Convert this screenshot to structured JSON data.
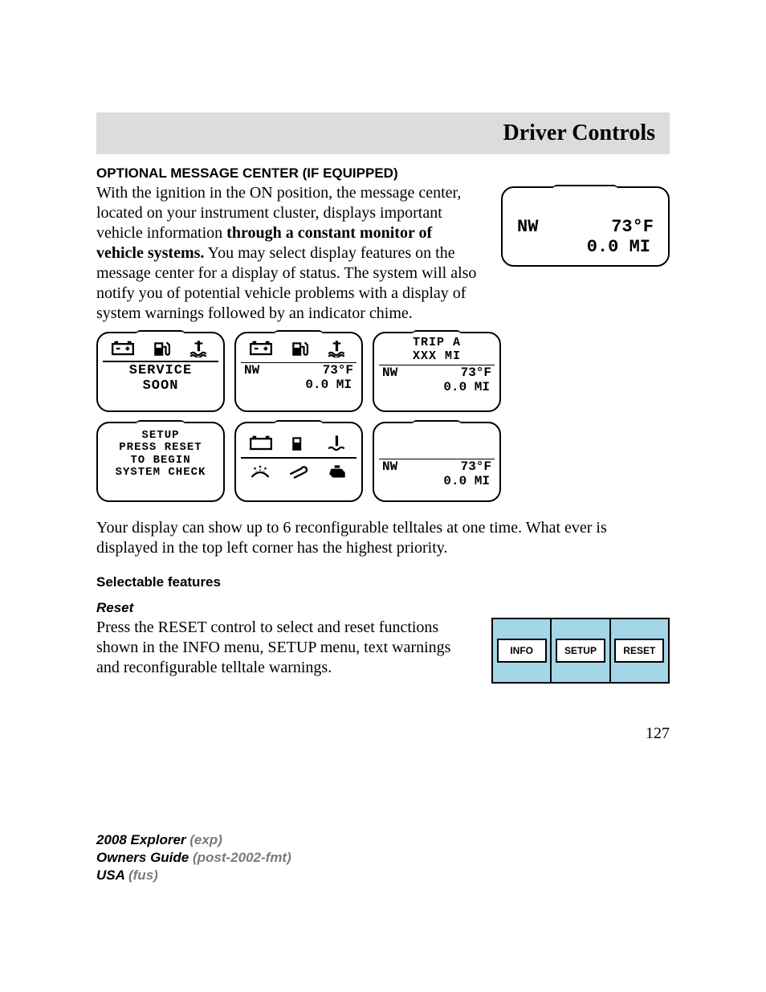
{
  "header": {
    "title": "Driver Controls"
  },
  "sections": {
    "s1_title": "OPTIONAL MESSAGE CENTER (IF EQUIPPED)",
    "s1_para1a": "With the ignition in the ON position, the message center, located on your instrument cluster, displays important vehicle information ",
    "s1_para1b_bold": "through a constant monitor of vehicle systems.",
    "s1_para1c": " You may select display features on the message center for a display of status. The system will also notify you of potential vehicle problems with a display of system warnings followed by an indicator chime.",
    "s1_para2": "Your display can show up to 6 reconfigurable telltales at one time. What ever is displayed in the top left corner has the highest priority.",
    "s2_title": "Selectable features",
    "reset_title": "Reset",
    "reset_para": "Press the RESET control to select and reset functions shown in the INFO menu, SETUP menu, text warnings and reconfigurable telltale warnings."
  },
  "lcd_main": {
    "compass": "NW",
    "temp": "73°F",
    "odo": "0.0 MI"
  },
  "lcd_cells": {
    "c1_l1": "SERVICE",
    "c1_l2": "SOON",
    "c2_comp": "NW",
    "c2_temp": "73°F",
    "c2_odo": "0.0 MI",
    "c3_l1": "TRIP A",
    "c3_l2": "XXX MI",
    "c3_comp": "NW",
    "c3_temp": "73°F",
    "c3_odo": "0.0 MI",
    "c4_l1": "SETUP",
    "c4_l2": "PRESS RESET",
    "c4_l3": "TO BEGIN",
    "c4_l4": "SYSTEM CHECK",
    "c6_comp": "NW",
    "c6_temp": "73°F",
    "c6_odo": "0.0 MI"
  },
  "buttons": {
    "b1": "INFO",
    "b2": "SETUP",
    "b3": "RESET"
  },
  "page_number": "127",
  "footer": {
    "l1a": "2008 Explorer",
    "l1b": " (exp)",
    "l2a": "Owners Guide",
    "l2b": " (post-2002-fmt)",
    "l3a": "USA",
    "l3b": " (fus)"
  }
}
